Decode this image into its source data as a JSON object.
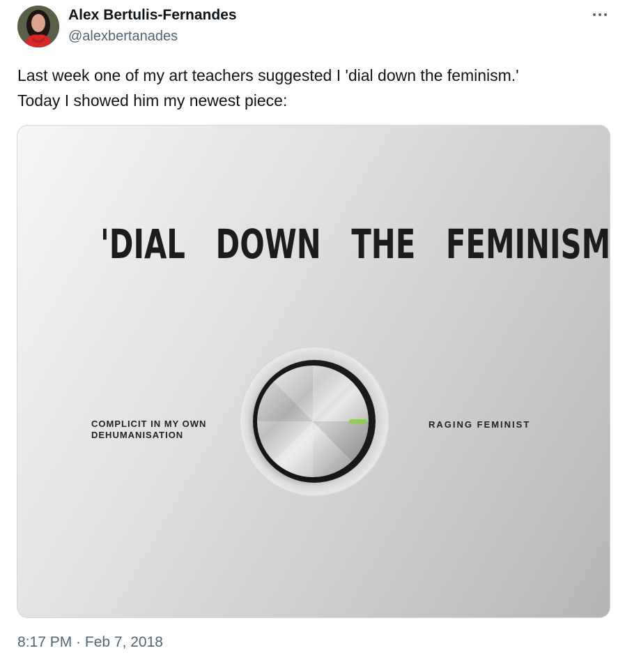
{
  "author": {
    "display_name": "Alex Bertulis-Fernandes",
    "handle": "@alexbertanades"
  },
  "tweet": {
    "lines": [
      "Last week one of my art teachers suggested I 'dial down the feminism.'",
      "Today I showed him my newest piece:"
    ],
    "timestamp": "8:17 PM · Feb 7, 2018"
  },
  "artwork": {
    "title": "'DIAL   DOWN   THE   FEMINISM'",
    "left_label": [
      "COMPLICIT IN MY OWN",
      "DEHUMANISATION"
    ],
    "right_label": "RAGING FEMINIST",
    "indicator_color": "#8fd14f"
  },
  "icons": {
    "more": "more-horizontal-icon",
    "avatar": "user-avatar"
  },
  "colors": {
    "text_primary": "#0f1419",
    "text_secondary": "#536471",
    "border": "#cfd9de"
  }
}
